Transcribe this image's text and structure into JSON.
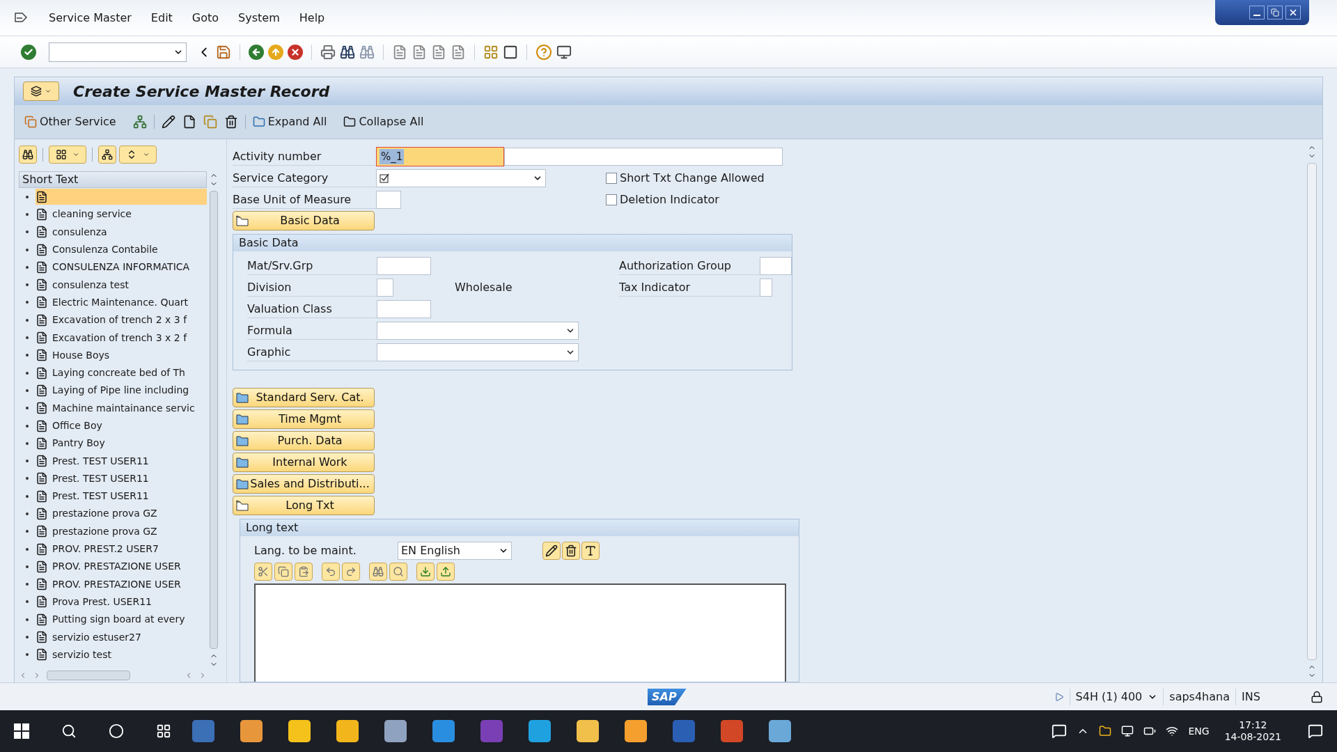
{
  "menu": [
    "Service Master",
    "Edit",
    "Goto",
    "System",
    "Help"
  ],
  "title": "Create Service Master Record",
  "app_toolbar": {
    "other_service": "Other Service",
    "expand_all": "Expand All",
    "collapse_all": "Collapse All"
  },
  "tree": {
    "header": "Short Text",
    "items": [
      {
        "selected": true
      },
      {
        "label": "cleaning service",
        "selected": false
      },
      {
        "label": "consulenza",
        "selected": false
      },
      {
        "label": "Consulenza Contabile",
        "selected": false
      },
      {
        "label": "CONSULENZA INFORMATICA",
        "selected": false
      },
      {
        "label": "consulenza test",
        "selected": false
      },
      {
        "label": "Electric Maintenance. Quart",
        "selected": false
      },
      {
        "label": "Excavation of trench 2 x 3 f",
        "selected": false
      },
      {
        "label": "Excavation of trench 3 x 2 f",
        "selected": false
      },
      {
        "label": "House Boys",
        "selected": false
      },
      {
        "label": "Laying concreate bed of Th",
        "selected": false
      },
      {
        "label": "Laying of Pipe line including",
        "selected": false
      },
      {
        "label": "Machine maintainance servic",
        "selected": false
      },
      {
        "label": "Office Boy",
        "selected": false
      },
      {
        "label": "Pantry Boy",
        "selected": false
      },
      {
        "label": "Prest. TEST USER11",
        "selected": false
      },
      {
        "label": "Prest. TEST USER11",
        "selected": false
      },
      {
        "label": "Prest. TEST USER11",
        "selected": false
      },
      {
        "label": "prestazione prova GZ",
        "selected": false
      },
      {
        "label": "prestazione prova GZ",
        "selected": false
      },
      {
        "label": "PROV. PREST.2 USER7",
        "selected": false
      },
      {
        "label": "PROV. PRESTAZIONE USER",
        "selected": false
      },
      {
        "label": "PROV. PRESTAZIONE USER",
        "selected": false
      },
      {
        "label": "Prova Prest. USER11",
        "selected": false
      },
      {
        "label": "Putting sign board at every",
        "selected": false
      },
      {
        "label": "servizio estuser27",
        "selected": false
      },
      {
        "label": "servizio test",
        "selected": false
      }
    ]
  },
  "header_fields": {
    "activity_number": {
      "label": "Activity number",
      "value": "%_1"
    },
    "service_category": {
      "label": "Service Category"
    },
    "base_unit": {
      "label": "Base Unit of Measure"
    }
  },
  "checkboxes": [
    {
      "label": "Short Txt Change Allowed",
      "checked": false
    },
    {
      "label": "Deletion Indicator",
      "checked": false
    }
  ],
  "sections": [
    {
      "label": "Basic Data",
      "expanded": true,
      "panel": {
        "kind": "basic",
        "title": "Basic Data",
        "left_fields": [
          {
            "label": "Mat/Srv.Grp",
            "kind": "input"
          },
          {
            "label": "Division",
            "kind": "short",
            "note": "Wholesale"
          },
          {
            "label": "Valuation Class",
            "kind": "input"
          },
          {
            "label": "Formula",
            "kind": "dropdown"
          },
          {
            "label": "Graphic",
            "kind": "dropdown"
          }
        ],
        "right_fields": [
          {
            "label": "Authorization Group",
            "kind": "input"
          },
          {
            "label": "Tax Indicator",
            "kind": "short"
          }
        ]
      }
    },
    {
      "label": "Standard Serv. Cat.",
      "expanded": false
    },
    {
      "label": "Time Mgmt",
      "expanded": false
    },
    {
      "label": "Purch. Data",
      "expanded": false
    },
    {
      "label": "Internal Work",
      "expanded": false
    },
    {
      "label": "Sales and Distributi...",
      "expanded": false
    },
    {
      "label": "Long Txt",
      "expanded": true,
      "panel": {
        "kind": "long_text",
        "title": "Long text",
        "language_label": "Lang. to be maint.",
        "language_value": "EN English"
      }
    }
  ],
  "status_bar": {
    "logo": "SAP",
    "system": "S4H (1) 400",
    "server": "saps4hana",
    "mode": "INS"
  },
  "taskbar": {
    "language": "ENG",
    "time": "17:12",
    "date": "14-08-2021"
  }
}
